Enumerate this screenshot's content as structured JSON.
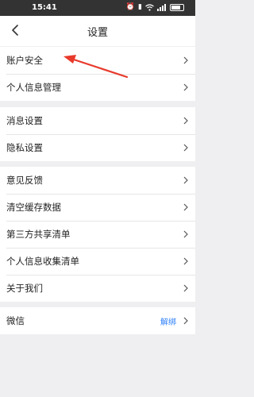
{
  "status_bar": {
    "time": "15:41",
    "icons": [
      "alarm-icon",
      "vibrate-icon",
      "wifi-icon",
      "signal-icon",
      "battery-icon"
    ],
    "battery_level": 0.8
  },
  "header": {
    "title": "设置"
  },
  "groups": [
    {
      "items": [
        {
          "label": "账户安全"
        },
        {
          "label": "个人信息管理"
        }
      ]
    },
    {
      "items": [
        {
          "label": "消息设置"
        },
        {
          "label": "隐私设置"
        }
      ]
    },
    {
      "items": [
        {
          "label": "意见反馈"
        },
        {
          "label": "清空缓存数据"
        },
        {
          "label": "第三方共享清单"
        },
        {
          "label": "个人信息收集清单"
        },
        {
          "label": "关于我们"
        }
      ]
    },
    {
      "items": [
        {
          "label": "微信",
          "value": "解绑"
        }
      ]
    }
  ],
  "colors": {
    "annotation_arrow": "#e8392b",
    "link": "#2d7ff9",
    "background": "#efeff1"
  }
}
